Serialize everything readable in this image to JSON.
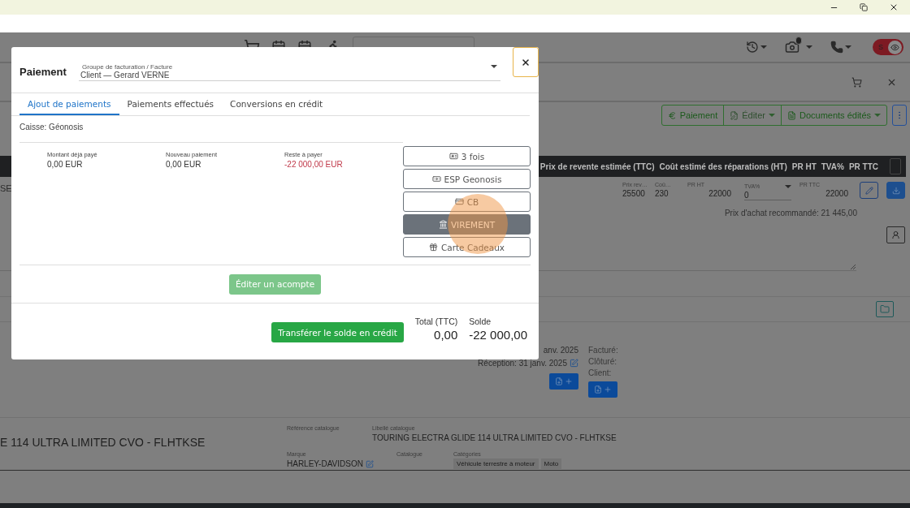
{
  "navbar": {
    "toggle": {
      "on": true,
      "label": "S"
    }
  },
  "actions": [
    {
      "label": "Paiement",
      "kind": "euro",
      "dropdown": false
    },
    {
      "label": "Éditer",
      "kind": "edit",
      "dropdown": true
    },
    {
      "label": "Documents édités",
      "kind": "document",
      "dropdown": true
    }
  ],
  "table": {
    "columns": [
      "Prix de revente estimée (TTC)",
      "Coût estimé des réparations (HT)",
      "PR HT",
      "TVA%",
      "PR TTC"
    ],
    "row_text": "SE",
    "fields": [
      {
        "label": "Prix rev…",
        "value": "25500",
        "kind": "text"
      },
      {
        "label": "Coû…",
        "value": "230",
        "kind": "text"
      },
      {
        "label": "PR HT",
        "value": "22000",
        "kind": "number"
      },
      {
        "label": "TVA%",
        "value": "0",
        "kind": "select"
      },
      {
        "label": "PR TTC",
        "value": "22000",
        "kind": "number"
      }
    ],
    "recommended": "Prix d'achat recommandé: 21 445,00"
  },
  "dates": {
    "lines": [
      {
        "text": "anv. 2025",
        "editable": false
      },
      {
        "text": "Réception: 31 janv. 2025",
        "editable": true
      }
    ],
    "labels": [
      "Facturé:",
      "Clôturé:",
      "Client:"
    ]
  },
  "product": {
    "title": "E 114 ULTRA LIMITED CVO - FLHTKSE",
    "reference_label": "Référence catalogue",
    "name_label": "Libellé catalogue",
    "name_value": "TOURING ELECTRA GLIDE 114 ULTRA LIMITED CVO - FLHTKSE",
    "brand_label": "Marque",
    "brand_value": "HARLEY-DAVIDSON",
    "catalogue_label": "Catalogue",
    "categories_label": "Catégories",
    "categories": [
      "Véhicule terrestre à moteur",
      "Moto"
    ]
  },
  "modal": {
    "title": "Paiement",
    "billing_select": {
      "label": "Groupe de facturation / Facture",
      "value": "Client — Gerard VERNE"
    },
    "tabs": [
      {
        "label": "Ajout de paiements",
        "selected": true
      },
      {
        "label": "Paiements effectués",
        "selected": false
      },
      {
        "label": "Conversions en crédit",
        "selected": false
      }
    ],
    "register": "Caisse: Géonosis",
    "amounts": [
      {
        "label": "Montant déjà payé",
        "value": "0,00 EUR",
        "negative": false
      },
      {
        "label": "Nouveau paiement",
        "value": "0,00 EUR",
        "negative": false
      },
      {
        "label": "Reste à payer",
        "value": "-22 000,00 EUR",
        "negative": true
      }
    ],
    "methods": [
      {
        "label": "3 fois",
        "kind": "installments",
        "selected": false
      },
      {
        "label": "ESP Geonosis",
        "kind": "cash",
        "selected": false
      },
      {
        "label": "CB",
        "kind": "card",
        "selected": false
      },
      {
        "label": "VIREMENT",
        "kind": "transfer",
        "selected": true
      },
      {
        "label": "Carte Cadeaux",
        "kind": "gift",
        "selected": false
      }
    ],
    "deposit_button": "Éditer un acompte",
    "transfer_button": "Transférer le solde en crédit",
    "totals": [
      {
        "label": "Total (TTC)",
        "value": "0,00"
      },
      {
        "label": "Solde",
        "value": "-22 000,00"
      }
    ]
  }
}
